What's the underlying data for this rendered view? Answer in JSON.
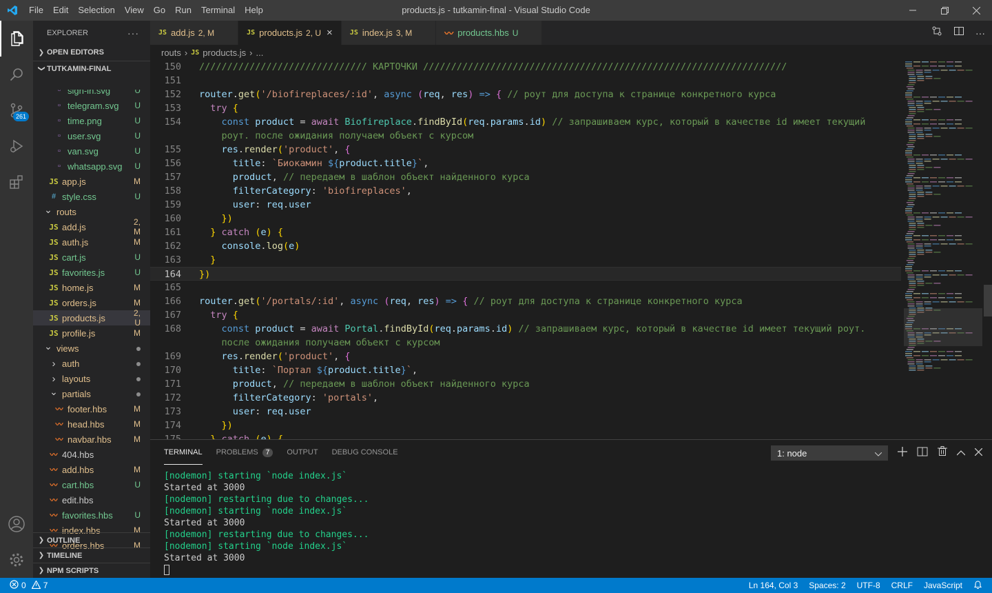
{
  "window": {
    "title": "products.js - tutkamin-final - Visual Studio Code"
  },
  "menu": [
    "File",
    "Edit",
    "Selection",
    "View",
    "Go",
    "Run",
    "Terminal",
    "Help"
  ],
  "activity": {
    "scm_badge": "261"
  },
  "sidebar": {
    "header": "EXPLORER",
    "more": "···",
    "open_editors": "OPEN EDITORS",
    "project": "TUTKAMIN-FINAL",
    "outline": "OUTLINE",
    "timeline": "TIMELINE",
    "npm": "NPM SCRIPTS",
    "tree": [
      {
        "name": "sign-in.svg",
        "status": "U",
        "kind": "img",
        "depth": 2
      },
      {
        "name": "telegram.svg",
        "status": "U",
        "kind": "img",
        "depth": 2
      },
      {
        "name": "time.png",
        "status": "U",
        "kind": "img",
        "depth": 2
      },
      {
        "name": "user.svg",
        "status": "U",
        "kind": "img",
        "depth": 2
      },
      {
        "name": "van.svg",
        "status": "U",
        "kind": "img",
        "depth": 2
      },
      {
        "name": "whatsapp.svg",
        "status": "U",
        "kind": "img",
        "depth": 2
      },
      {
        "name": "app.js",
        "status": "M",
        "kind": "js",
        "depth": 1
      },
      {
        "name": "style.css",
        "status": "U",
        "kind": "css",
        "depth": 1
      },
      {
        "name": "routs",
        "status": "",
        "kind": "folder-open",
        "depth": 0
      },
      {
        "name": "add.js",
        "status": "2, M",
        "kind": "js",
        "depth": 1
      },
      {
        "name": "auth.js",
        "status": "M",
        "kind": "js",
        "depth": 1
      },
      {
        "name": "cart.js",
        "status": "U",
        "kind": "js",
        "depth": 1
      },
      {
        "name": "favorites.js",
        "status": "U",
        "kind": "js",
        "depth": 1
      },
      {
        "name": "home.js",
        "status": "M",
        "kind": "js",
        "depth": 1
      },
      {
        "name": "orders.js",
        "status": "M",
        "kind": "js",
        "depth": 1
      },
      {
        "name": "products.js",
        "status": "2, U",
        "kind": "js",
        "depth": 1,
        "selected": true
      },
      {
        "name": "profile.js",
        "status": "M",
        "kind": "js",
        "depth": 1
      },
      {
        "name": "views",
        "status": "dot",
        "kind": "folder-open",
        "depth": 0
      },
      {
        "name": "auth",
        "status": "dot",
        "kind": "folder",
        "depth": 1
      },
      {
        "name": "layouts",
        "status": "dot",
        "kind": "folder",
        "depth": 1
      },
      {
        "name": "partials",
        "status": "dot",
        "kind": "folder-open",
        "depth": 1
      },
      {
        "name": "footer.hbs",
        "status": "M",
        "kind": "hbs",
        "depth": 2
      },
      {
        "name": "head.hbs",
        "status": "M",
        "kind": "hbs",
        "depth": 2
      },
      {
        "name": "navbar.hbs",
        "status": "M",
        "kind": "hbs",
        "depth": 2
      },
      {
        "name": "404.hbs",
        "status": "",
        "kind": "hbs",
        "depth": 1
      },
      {
        "name": "add.hbs",
        "status": "M",
        "kind": "hbs",
        "depth": 1
      },
      {
        "name": "cart.hbs",
        "status": "U",
        "kind": "hbs",
        "depth": 1
      },
      {
        "name": "edit.hbs",
        "status": "",
        "kind": "hbs",
        "depth": 1
      },
      {
        "name": "favorites.hbs",
        "status": "U",
        "kind": "hbs",
        "depth": 1
      },
      {
        "name": "index.hbs",
        "status": "M",
        "kind": "hbs",
        "depth": 1
      },
      {
        "name": "orders.hbs",
        "status": "M",
        "kind": "hbs",
        "depth": 1
      }
    ]
  },
  "tabs": [
    {
      "icon": "JS",
      "name": "add.js",
      "badge": "2, M",
      "color": "#e2c08d"
    },
    {
      "icon": "JS",
      "name": "products.js",
      "badge": "2, U",
      "color": "#e2c08d",
      "active": true,
      "close": "×"
    },
    {
      "icon": "JS",
      "name": "index.js",
      "badge": "3, M",
      "color": "#e2c08d"
    },
    {
      "icon": "hbs",
      "name": "products.hbs",
      "badge": "U",
      "color": "#73c991"
    }
  ],
  "breadcrumb": {
    "folder": "routs",
    "icon": "JS",
    "file": "products.js",
    "tail": "..."
  },
  "code": {
    "current_line": "164",
    "lines": [
      {
        "n": "150",
        "t": "////////////////////////////// КАРТОЧКИ /////////////////////////////////////////////////////////////////"
      },
      {
        "n": "151",
        "t": ""
      },
      {
        "n": "152",
        "t": "router.get('/biofireplaces/:id', async (req, res) => { // роут для доступа к странице конкретного курса"
      },
      {
        "n": "153",
        "t": "  try {"
      },
      {
        "n": "154",
        "t": "    const product = await Biofireplace.findById(req.params.id) // запрашиваем курс, который в качестве id имеет текущий"
      },
      {
        "n": "",
        "t": "    роут. после ожидания получаем объект с курсом"
      },
      {
        "n": "155",
        "t": "    res.render('product', {"
      },
      {
        "n": "156",
        "t": "      title: `Биокамин ${product.title}`,"
      },
      {
        "n": "157",
        "t": "      product, // передаем в шаблон объект найденного курса"
      },
      {
        "n": "158",
        "t": "      filterCategory: 'biofireplaces',"
      },
      {
        "n": "159",
        "t": "      user: req.user"
      },
      {
        "n": "160",
        "t": "    })"
      },
      {
        "n": "161",
        "t": "  } catch (e) {"
      },
      {
        "n": "162",
        "t": "    console.log(e)"
      },
      {
        "n": "163",
        "t": "  }"
      },
      {
        "n": "164",
        "t": "})"
      },
      {
        "n": "165",
        "t": ""
      },
      {
        "n": "166",
        "t": "router.get('/portals/:id', async (req, res) => { // роут для доступа к странице конкретного курса"
      },
      {
        "n": "167",
        "t": "  try {"
      },
      {
        "n": "168",
        "t": "    const product = await Portal.findById(req.params.id) // запрашиваем курс, который в качестве id имеет текущий роут."
      },
      {
        "n": "",
        "t": "    после ожидания получаем объект с курсом"
      },
      {
        "n": "169",
        "t": "    res.render('product', {"
      },
      {
        "n": "170",
        "t": "      title: `Портал ${product.title}`,"
      },
      {
        "n": "171",
        "t": "      product, // передаем в шаблон объект найденного курса"
      },
      {
        "n": "172",
        "t": "      filterCategory: 'portals',"
      },
      {
        "n": "173",
        "t": "      user: req.user"
      },
      {
        "n": "174",
        "t": "    })"
      },
      {
        "n": "175",
        "t": "  } catch (e) {"
      }
    ]
  },
  "panel": {
    "tabs": [
      {
        "label": "TERMINAL",
        "active": true
      },
      {
        "label": "PROBLEMS",
        "badge": "7"
      },
      {
        "label": "OUTPUT"
      },
      {
        "label": "DEBUG CONSOLE"
      }
    ],
    "terminal_select": "1: node",
    "lines": [
      {
        "text": "[nodemon] starting `node index.js`",
        "style": "green"
      },
      {
        "text": "Started at 3000",
        "style": "white"
      },
      {
        "text": "[nodemon] restarting due to changes...",
        "style": "green"
      },
      {
        "text": "[nodemon] starting `node index.js`",
        "style": "green"
      },
      {
        "text": "Started at 3000",
        "style": "white"
      },
      {
        "text": "[nodemon] restarting due to changes...",
        "style": "green"
      },
      {
        "text": "[nodemon] starting `node index.js`",
        "style": "green"
      },
      {
        "text": "Started at 3000",
        "style": "white"
      }
    ]
  },
  "status": {
    "errors": "0",
    "warnings": "7",
    "position": "Ln 164, Col 3",
    "spaces": "Spaces: 2",
    "encoding": "UTF-8",
    "eol": "CRLF",
    "language": "JavaScript"
  }
}
